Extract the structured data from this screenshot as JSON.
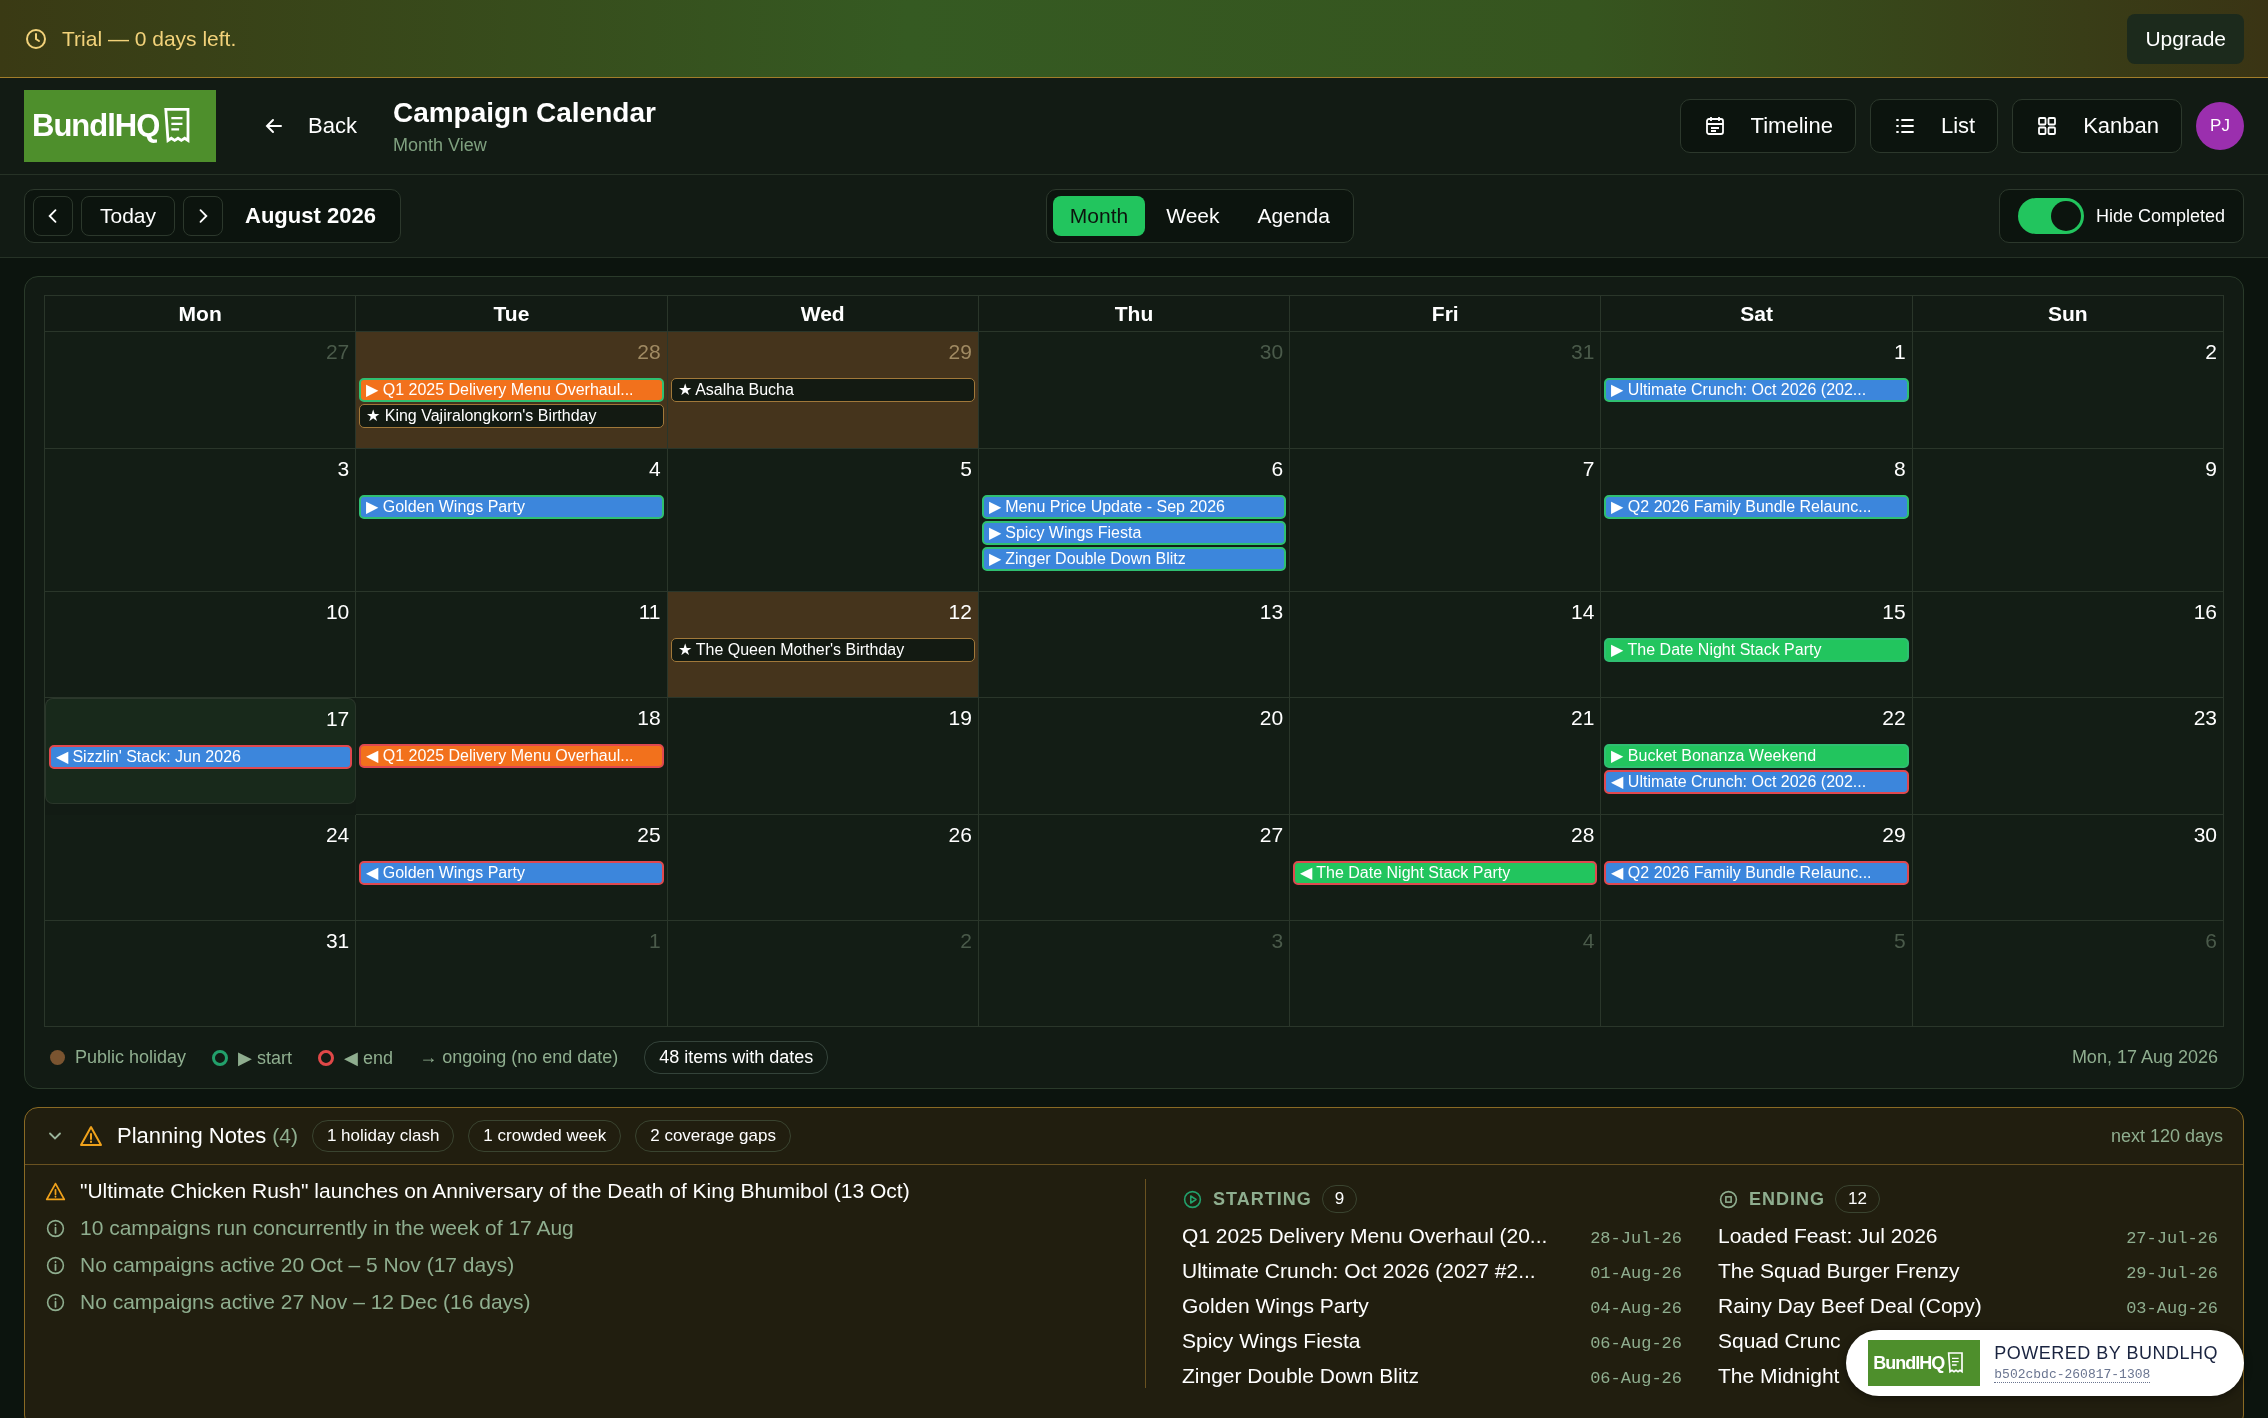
{
  "trial_banner": {
    "text": "Trial — 0 days left.",
    "button": "Upgrade"
  },
  "header": {
    "logo": "BundlHQ",
    "back": "Back",
    "title": "Campaign Calendar",
    "subtitle": "Month View",
    "avatar": "PJ",
    "views": [
      {
        "kind": "timeline",
        "label": "Timeline"
      },
      {
        "kind": "list",
        "label": "List"
      },
      {
        "kind": "kanban",
        "label": "Kanban"
      }
    ]
  },
  "toolbar": {
    "today": "Today",
    "month": "August 2026",
    "modes": [
      {
        "label": "Month",
        "selected": true
      },
      {
        "label": "Week",
        "selected": false
      },
      {
        "label": "Agenda",
        "selected": false
      }
    ],
    "hide_completed": {
      "label": "Hide Completed",
      "on": true
    }
  },
  "calendar": {
    "weekdays": [
      "Mon",
      "Tue",
      "Wed",
      "Thu",
      "Fri",
      "Sat",
      "Sun"
    ],
    "weeks": [
      [
        {
          "day": "27",
          "muted": true,
          "holiday": false,
          "today": false
        },
        {
          "day": "28",
          "muted": true,
          "holiday": true,
          "today": false,
          "events": [
            {
              "kind": "start",
              "label": "▶ Q1 2025 Delivery Menu Overhaul...",
              "color": "#f2711c"
            },
            {
              "kind": "holiday",
              "label": "★ King Vajiralongkorn's Birthday"
            }
          ]
        },
        {
          "day": "29",
          "muted": true,
          "holiday": true,
          "today": false,
          "events": [
            {
              "kind": "holiday",
              "label": "★ Asalha Bucha"
            }
          ]
        },
        {
          "day": "30",
          "muted": true,
          "holiday": false,
          "today": false
        },
        {
          "day": "31",
          "muted": true,
          "holiday": false,
          "today": false
        },
        {
          "day": "1",
          "muted": false,
          "holiday": false,
          "today": false,
          "events": [
            {
              "kind": "start",
              "label": "▶ Ultimate Crunch: Oct 2026 (202...",
              "color": "#3c86dc"
            }
          ]
        },
        {
          "day": "2",
          "muted": false,
          "holiday": false,
          "today": false
        }
      ],
      [
        {
          "day": "3",
          "muted": false,
          "holiday": false,
          "today": false
        },
        {
          "day": "4",
          "muted": false,
          "holiday": false,
          "today": false,
          "events": [
            {
              "kind": "start",
              "label": "▶ Golden Wings Party",
              "color": "#3c86dc"
            }
          ]
        },
        {
          "day": "5",
          "muted": false,
          "holiday": false,
          "today": false
        },
        {
          "day": "6",
          "muted": false,
          "holiday": false,
          "today": false,
          "events": [
            {
              "kind": "start",
              "label": "▶ Menu Price Update - Sep 2026",
              "color": "#3c86dc"
            },
            {
              "kind": "start",
              "label": "▶ Spicy Wings Fiesta",
              "color": "#3c86dc"
            },
            {
              "kind": "start",
              "label": "▶ Zinger Double Down Blitz",
              "color": "#3c86dc"
            }
          ]
        },
        {
          "day": "7",
          "muted": false,
          "holiday": false,
          "today": false
        },
        {
          "day": "8",
          "muted": false,
          "holiday": false,
          "today": false,
          "events": [
            {
              "kind": "start",
              "label": "▶ Q2 2026 Family Bundle Relaunc...",
              "color": "#3c86dc"
            }
          ]
        },
        {
          "day": "9",
          "muted": false,
          "holiday": false,
          "today": false
        }
      ],
      [
        {
          "day": "10",
          "muted": false,
          "holiday": false,
          "today": false
        },
        {
          "day": "11",
          "muted": false,
          "holiday": false,
          "today": false
        },
        {
          "day": "12",
          "muted": false,
          "holiday": true,
          "today": false,
          "events": [
            {
              "kind": "holiday",
              "label": "★ The Queen Mother's Birthday"
            }
          ]
        },
        {
          "day": "13",
          "muted": false,
          "holiday": false,
          "today": false
        },
        {
          "day": "14",
          "muted": false,
          "holiday": false,
          "today": false
        },
        {
          "day": "15",
          "muted": false,
          "holiday": false,
          "today": false,
          "events": [
            {
              "kind": "start",
              "label": "▶ The Date Night Stack Party",
              "color": "#22c55e"
            }
          ]
        },
        {
          "day": "16",
          "muted": false,
          "holiday": false,
          "today": false
        }
      ],
      [
        {
          "day": "17",
          "muted": false,
          "holiday": false,
          "today": true,
          "events": [
            {
              "kind": "end",
              "label": "◀ Sizzlin' Stack: Jun 2026",
              "color": "#3c86dc"
            }
          ]
        },
        {
          "day": "18",
          "muted": false,
          "holiday": false,
          "today": false,
          "events": [
            {
              "kind": "end",
              "label": "◀ Q1 2025 Delivery Menu Overhaul...",
              "color": "#f2711c"
            }
          ]
        },
        {
          "day": "19",
          "muted": false,
          "holiday": false,
          "today": false
        },
        {
          "day": "20",
          "muted": false,
          "holiday": false,
          "today": false
        },
        {
          "day": "21",
          "muted": false,
          "holiday": false,
          "today": false
        },
        {
          "day": "22",
          "muted": false,
          "holiday": false,
          "today": false,
          "events": [
            {
              "kind": "start",
              "label": "▶ Bucket Bonanza Weekend",
              "color": "#22c55e"
            },
            {
              "kind": "end",
              "label": "◀ Ultimate Crunch: Oct 2026 (202...",
              "color": "#3c86dc"
            }
          ]
        },
        {
          "day": "23",
          "muted": false,
          "holiday": false,
          "today": false
        }
      ],
      [
        {
          "day": "24",
          "muted": false,
          "holiday": false,
          "today": false
        },
        {
          "day": "25",
          "muted": false,
          "holiday": false,
          "today": false,
          "events": [
            {
              "kind": "end",
              "label": "◀ Golden Wings Party",
              "color": "#3c86dc"
            }
          ]
        },
        {
          "day": "26",
          "muted": false,
          "holiday": false,
          "today": false
        },
        {
          "day": "27",
          "muted": false,
          "holiday": false,
          "today": false
        },
        {
          "day": "28",
          "muted": false,
          "holiday": false,
          "today": false,
          "events": [
            {
              "kind": "end",
              "label": "◀ The Date Night Stack Party",
              "color": "#22c55e"
            }
          ]
        },
        {
          "day": "29",
          "muted": false,
          "holiday": false,
          "today": false,
          "events": [
            {
              "kind": "end",
              "label": "◀ Q2 2026 Family Bundle Relaunc...",
              "color": "#3c86dc"
            }
          ]
        },
        {
          "day": "30",
          "muted": false,
          "holiday": false,
          "today": false
        }
      ],
      [
        {
          "day": "31",
          "muted": false,
          "holiday": false,
          "today": false
        },
        {
          "day": "1",
          "muted": true,
          "holiday": false,
          "today": false
        },
        {
          "day": "2",
          "muted": true,
          "holiday": false,
          "today": false
        },
        {
          "day": "3",
          "muted": true,
          "holiday": false,
          "today": false
        },
        {
          "day": "4",
          "muted": true,
          "holiday": false,
          "today": false
        },
        {
          "day": "5",
          "muted": true,
          "holiday": false,
          "today": false
        },
        {
          "day": "6",
          "muted": true,
          "holiday": false,
          "today": false
        }
      ]
    ],
    "legend": [
      {
        "kind": "holiday",
        "label": "Public holiday",
        "color": "#7a5430"
      },
      {
        "kind": "start",
        "label": "▶ start",
        "color": "#22a06b"
      },
      {
        "kind": "end",
        "label": "◀ end",
        "color": "#e04848"
      },
      {
        "kind": "ongoing",
        "label": "→ ongoing (no end date)"
      }
    ],
    "count": "48 items with dates",
    "current_date": "Mon, 17 Aug 2026"
  },
  "planning_notes": {
    "title": "Planning Notes",
    "count": "(4)",
    "expanded": true,
    "range": "next 120 days",
    "tags": [
      "1 holiday clash",
      "1 crowded week",
      "2 coverage gaps"
    ],
    "notes": [
      {
        "kind": "warning",
        "text": "\"Ultimate Chicken Rush\" launches on Anniversary of the Death of King Bhumibol (13 Oct)"
      },
      {
        "kind": "info",
        "text": "10 campaigns run concurrently in the week of 17 Aug"
      },
      {
        "kind": "info",
        "text": "No campaigns active 20 Oct – 5 Nov (17 days)"
      },
      {
        "kind": "info",
        "text": "No campaigns active 27 Nov – 12 Dec (16 days)"
      }
    ],
    "lists": [
      {
        "kind": "starting",
        "label": "STARTING",
        "count": "9",
        "items": [
          {
            "title": "Q1 2025 Delivery Menu Overhaul (20...",
            "date": "28-Jul-26"
          },
          {
            "title": "Ultimate Crunch: Oct 2026 (2027 #2...",
            "date": "01-Aug-26"
          },
          {
            "title": "Golden Wings Party",
            "date": "04-Aug-26"
          },
          {
            "title": "Spicy Wings Fiesta",
            "date": "06-Aug-26"
          },
          {
            "title": "Zinger Double Down Blitz",
            "date": "06-Aug-26"
          }
        ]
      },
      {
        "kind": "ending",
        "label": "ENDING",
        "count": "12",
        "items": [
          {
            "title": "Loaded Feast: Jul 2026",
            "date": "27-Jul-26"
          },
          {
            "title": "The Squad Burger Frenzy",
            "date": "29-Jul-26"
          },
          {
            "title": "Rainy Day Beef Deal (Copy)",
            "date": "03-Aug-26"
          },
          {
            "title": "Squad Crunc"
          },
          {
            "title": "The Midnight"
          }
        ]
      }
    ]
  },
  "badge": {
    "logo": "BundlHQ",
    "title": "POWERED BY BUNDLHQ",
    "build": "b502cbdc-260817-1308"
  }
}
